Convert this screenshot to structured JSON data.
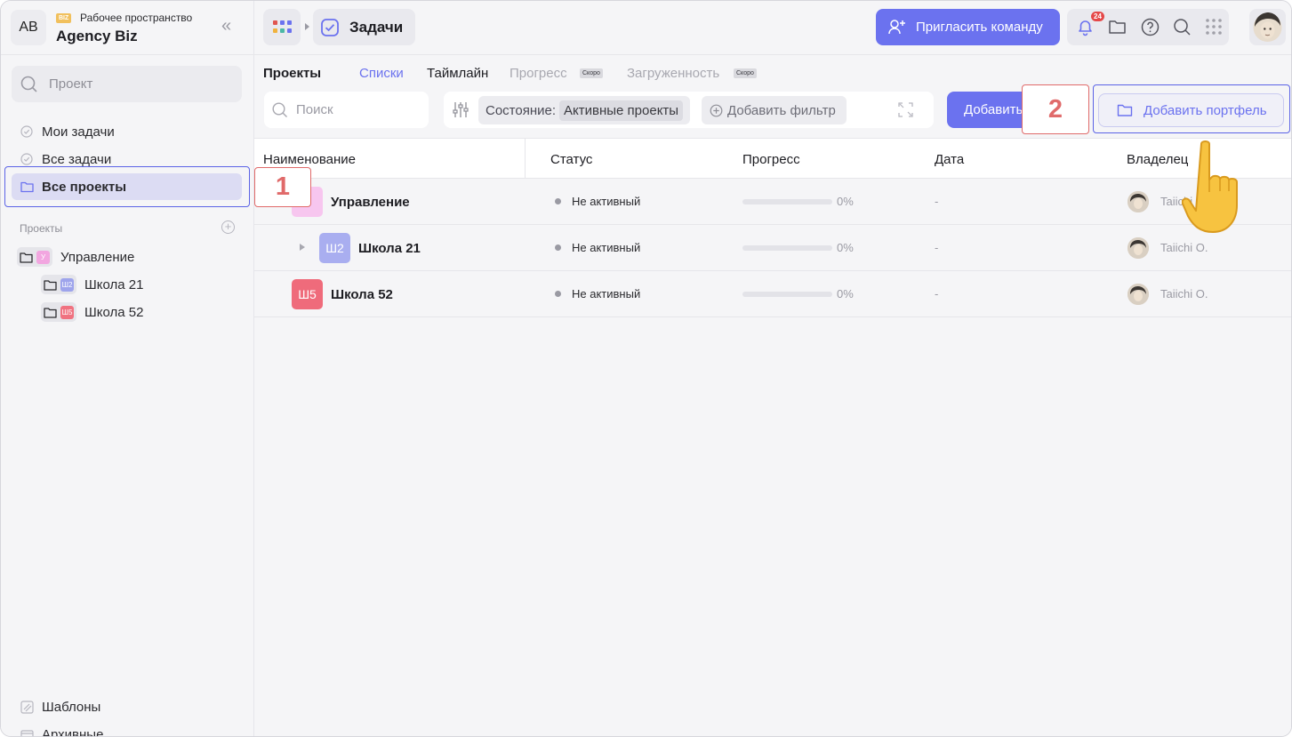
{
  "workspace": {
    "avatar_initials": "AB",
    "badge": "BIZ",
    "subtitle": "Рабочее пространство",
    "name": "Agency Biz"
  },
  "sidebar": {
    "search_placeholder": "Проект",
    "nav": [
      {
        "label": "Мои задачи",
        "icon": "check-circle-icon"
      },
      {
        "label": "Все задачи",
        "icon": "check-circle-icon"
      },
      {
        "label": "Все проекты",
        "icon": "folder-icon",
        "active": true
      }
    ],
    "projects_section_title": "Проекты",
    "tree": [
      {
        "initials": "У",
        "label": "Управление",
        "color": "#f2a6e0"
      },
      {
        "initials": "Ш2",
        "label": "Школа 21",
        "color": "#9ea4ec"
      },
      {
        "initials": "Ш5",
        "label": "Школа 52",
        "color": "#f07280"
      }
    ],
    "bottom": [
      {
        "label": "Шаблоны",
        "icon": "templates-icon"
      },
      {
        "label": "Архивные",
        "icon": "archive-icon"
      }
    ]
  },
  "topbar": {
    "breadcrumb_title": "Задачи",
    "invite_label": "Пригласить команду",
    "notification_count": "24"
  },
  "tabs": [
    {
      "label": "Проекты",
      "state": "title"
    },
    {
      "label": "Списки",
      "state": "active"
    },
    {
      "label": "Таймлайн",
      "state": "normal"
    },
    {
      "label": "Прогресс",
      "state": "disabled",
      "soon": "Скоро"
    },
    {
      "label": "Загруженность",
      "state": "disabled",
      "soon": "Скоро"
    }
  ],
  "toolbar": {
    "search_placeholder": "Поиск",
    "state_label": "Состояние:",
    "state_value": "Активные проекты",
    "add_filter_label": "Добавить фильтр",
    "add_label": "Добавить",
    "add_portfolio_label": "Добавить портфель"
  },
  "steps": {
    "one": "1",
    "two": "2"
  },
  "table": {
    "headers": [
      "Наименование",
      "Статус",
      "Прогресс",
      "Дата",
      "Владелец"
    ],
    "rows": [
      {
        "initials": "",
        "name": "Управление",
        "status": "Не активный",
        "progress": 0,
        "progress_text": "0%",
        "date": "-",
        "owner": "Taiichi O.",
        "color": "#f7c6ef"
      },
      {
        "initials": "Ш2",
        "name": "Школа 21",
        "status": "Не активный",
        "progress": 0,
        "progress_text": "0%",
        "date": "-",
        "owner": "Taiichi O.",
        "color": "#a9aef0"
      },
      {
        "initials": "Ш5",
        "name": "Школа 52",
        "status": "Не активный",
        "progress": 0,
        "progress_text": "0%",
        "date": "-",
        "owner": "Taiichi O.",
        "color": "#ef6b7b"
      }
    ]
  },
  "colors": {
    "accent": "#6b72ef",
    "highlight_step": "#e06a6a"
  }
}
